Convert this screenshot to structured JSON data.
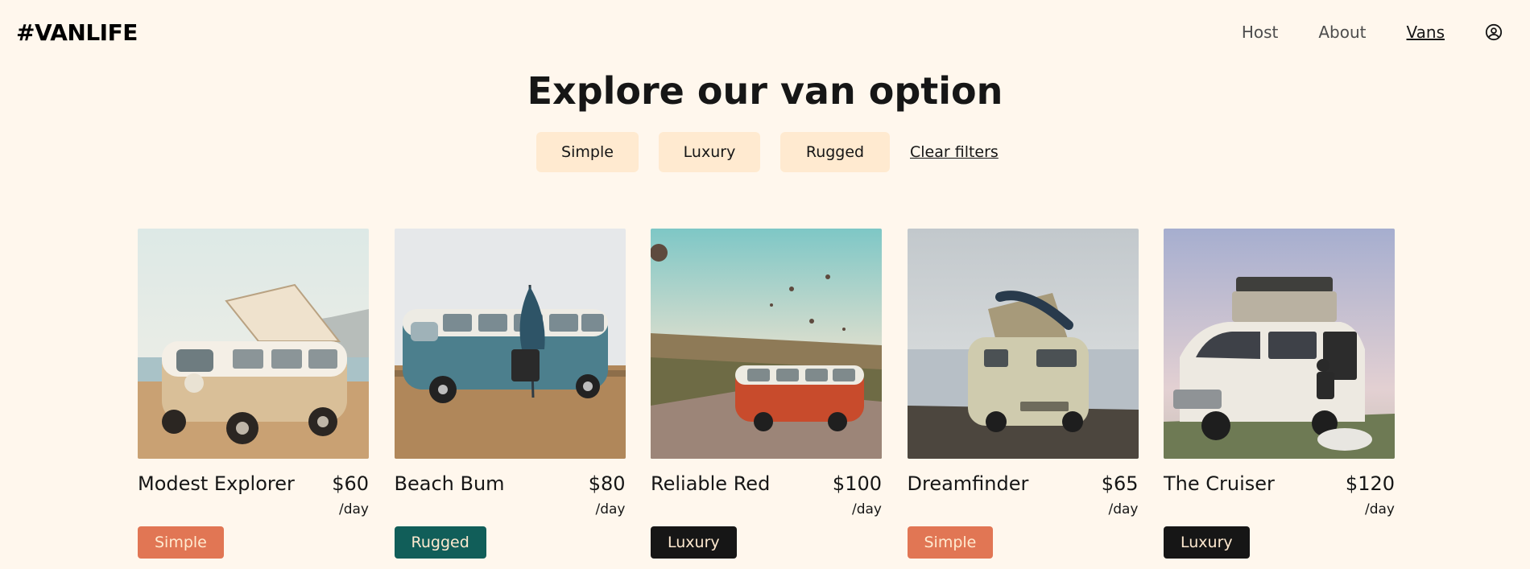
{
  "header": {
    "logo": "#VANLIFE",
    "nav": [
      "Host",
      "About",
      "Vans"
    ],
    "active_nav": "Vans",
    "user_icon": "user-circle-icon"
  },
  "page_title": "Explore our van option",
  "filters": {
    "options": [
      "Simple",
      "Luxury",
      "Rugged"
    ],
    "clear_label": "Clear filters"
  },
  "vans": [
    {
      "name": "Modest Explorer",
      "price": "$60",
      "per": "/day",
      "type": "Simple"
    },
    {
      "name": "Beach Bum",
      "price": "$80",
      "per": "/day",
      "type": "Rugged"
    },
    {
      "name": "Reliable Red",
      "price": "$100",
      "per": "/day",
      "type": "Luxury"
    },
    {
      "name": "Dreamfinder",
      "price": "$65",
      "per": "/day",
      "type": "Simple"
    },
    {
      "name": "The Cruiser",
      "price": "$120",
      "per": "/day",
      "type": "Luxury"
    }
  ],
  "colors": {
    "background": "#FFF7ED",
    "filter_bg": "#FFEAD0",
    "simple": "#E17654",
    "rugged": "#115E59",
    "luxury": "#161616"
  }
}
